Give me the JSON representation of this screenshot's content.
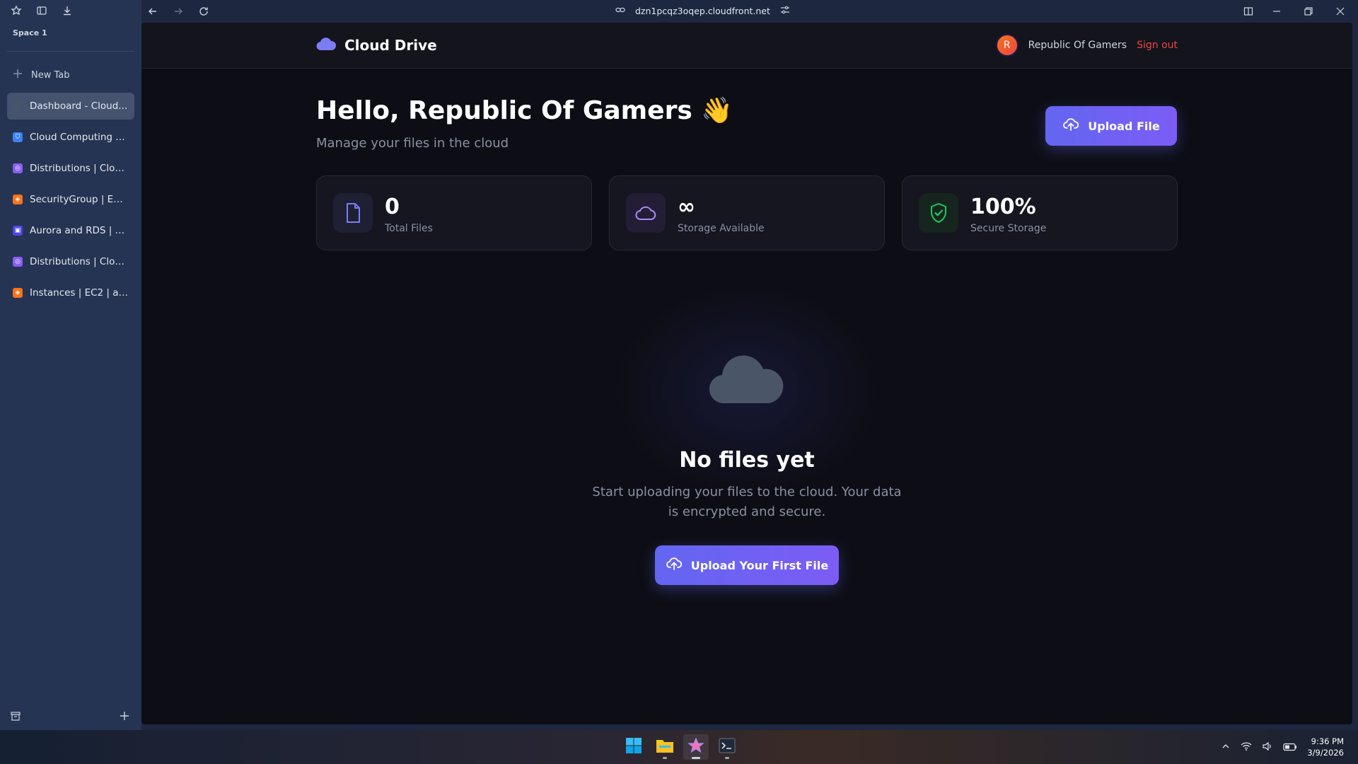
{
  "browser": {
    "space_label": "Space 1",
    "new_tab_label": "New Tab",
    "url": "dzn1pcqz3oqep.cloudfront.net",
    "tabs": [
      {
        "label": "Dashboard - Cloud...",
        "favicon_color": "#475569",
        "active": true
      },
      {
        "label": "Cloud Computing S...",
        "favicon_color": "#3b82f6",
        "active": false
      },
      {
        "label": "Distributions | Cloud...",
        "favicon_color": "#8b5cf6",
        "active": false
      },
      {
        "label": "SecurityGroup | EC2...",
        "favicon_color": "#f97316",
        "active": false
      },
      {
        "label": "Aurora and RDS | ap...",
        "favicon_color": "#4f46e5",
        "active": false
      },
      {
        "label": "Distributions | Cloud...",
        "favicon_color": "#8b5cf6",
        "active": false
      },
      {
        "label": "Instances | EC2 | ap-...",
        "favicon_color": "#f97316",
        "active": false
      }
    ]
  },
  "app": {
    "brand": "Cloud Drive",
    "user": {
      "initial": "R",
      "name": "Republic Of Gamers",
      "signout_label": "Sign out"
    },
    "greeting": "Hello, Republic Of Gamers 👋",
    "subtitle": "Manage your files in the cloud",
    "upload_button": "Upload File",
    "stats": [
      {
        "value": "0",
        "label": "Total Files",
        "icon": "file-icon"
      },
      {
        "value": "∞",
        "label": "Storage Available",
        "icon": "cloud-icon"
      },
      {
        "value": "100%",
        "label": "Secure Storage",
        "icon": "shield-check-icon"
      }
    ],
    "empty_state": {
      "title": "No files yet",
      "description": "Start uploading your files to the cloud. Your data is encrypted and secure.",
      "button": "Upload Your First File"
    },
    "colors": {
      "accent": "#6366f1",
      "danger": "#ef4444",
      "success": "#22c55e"
    }
  },
  "taskbar": {
    "time": "9:36 PM",
    "date": "3/9/2026"
  }
}
